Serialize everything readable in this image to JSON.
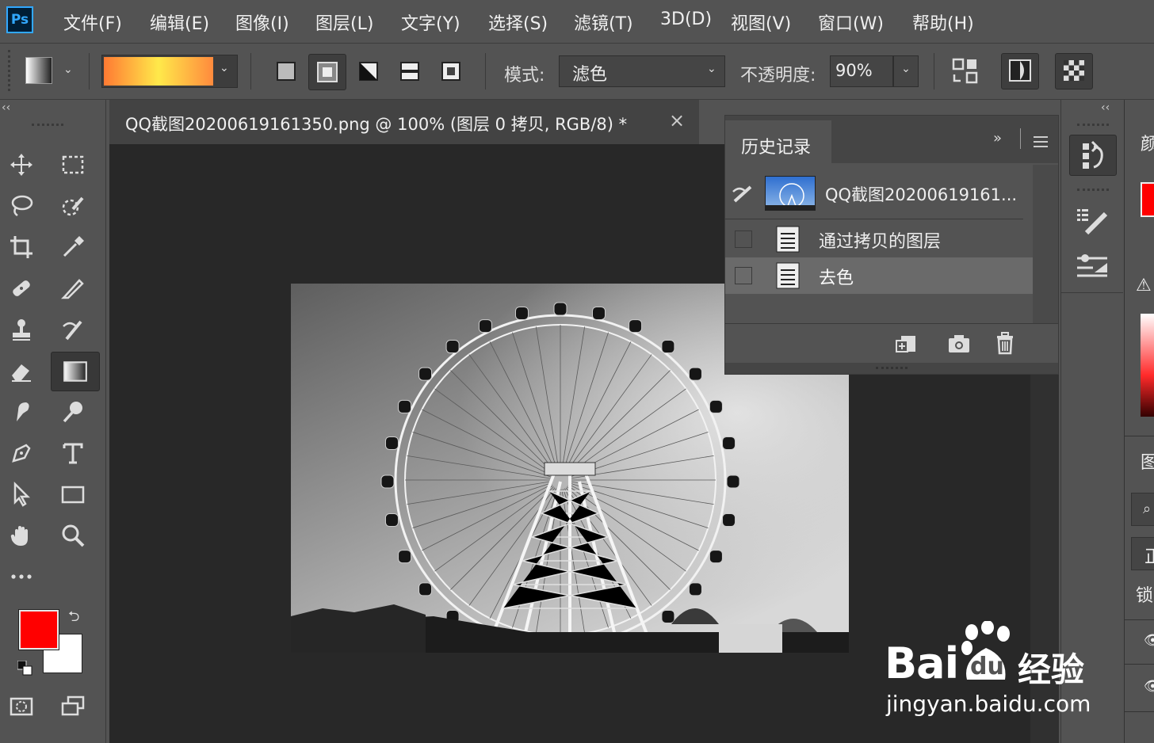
{
  "app": {
    "logo_text": "Ps"
  },
  "menu": [
    "文件(F)",
    "编辑(E)",
    "图像(I)",
    "图层(L)",
    "文字(Y)",
    "选择(S)",
    "滤镜(T)",
    "3D(D)",
    "视图(V)",
    "窗口(W)",
    "帮助(H)"
  ],
  "options": {
    "mode_label": "模式:",
    "mode_value": "滤色",
    "opacity_label": "不透明度:",
    "opacity_value": "90%",
    "gradient_colors": [
      "#ff7a33",
      "#ffe94a",
      "#ff8a3d"
    ]
  },
  "document": {
    "tab_title": "QQ截图20200619161350.png @ 100% (图层 0 拷贝, RGB/8) *",
    "close_glyph": "×"
  },
  "history": {
    "title": "历史记录",
    "expand_glyph": "»",
    "snapshot_label": "QQ截图20200619161...",
    "items": [
      {
        "label": "通过拷贝的图层"
      },
      {
        "label": "去色"
      }
    ]
  },
  "colors": {
    "foreground": "#ff0000",
    "background": "#ffffff",
    "accent": "#31a8ff"
  },
  "collapse_glyph": "‹‹",
  "far_right": {
    "labels": [
      "颜",
      "图",
      "正",
      "锁"
    ]
  },
  "watermark": {
    "brand": "Bai",
    "brand_2": "du",
    "cn": "经验",
    "url": "jingyan.baidu.com"
  }
}
